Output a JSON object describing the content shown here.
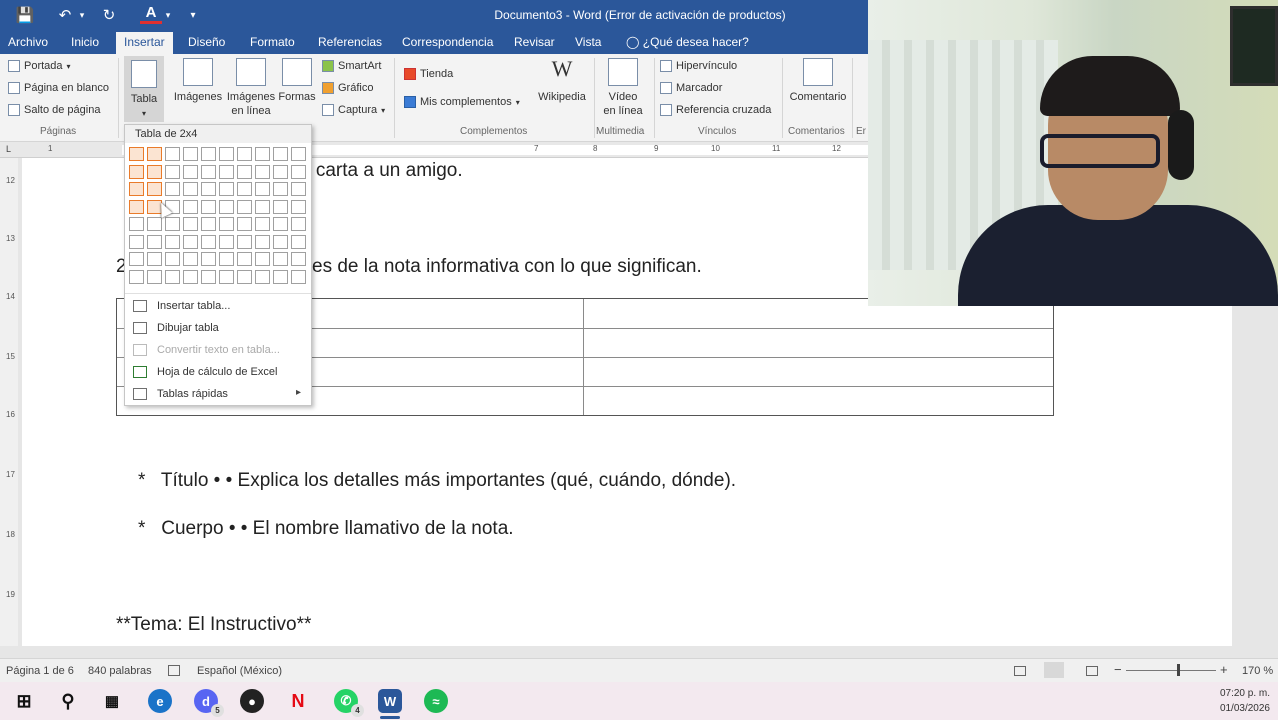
{
  "titlebar": {
    "doc_title": "Documento3 - Word (Error de activación de productos)"
  },
  "tabs": [
    {
      "label": "Archivo"
    },
    {
      "label": "Inicio"
    },
    {
      "label": "Insertar"
    },
    {
      "label": "Diseño"
    },
    {
      "label": "Formato"
    },
    {
      "label": "Referencias"
    },
    {
      "label": "Correspondencia"
    },
    {
      "label": "Revisar"
    },
    {
      "label": "Vista"
    }
  ],
  "tell_me": "¿Qué desea hacer?",
  "ribbon": {
    "paginas": {
      "portada": "Portada",
      "pagina_blanco": "Página en blanco",
      "salto": "Salto de página",
      "group": "Páginas"
    },
    "tabla": "Tabla",
    "imagenes": "Imágenes",
    "imagenes_linea": "Imágenes en línea",
    "formas": "Formas",
    "smartart": "SmartArt",
    "grafico": "Gráfico",
    "captura": "Captura",
    "tienda": "Tienda",
    "mis_complementos": "Mis complementos",
    "wikipedia": "Wikipedia",
    "complementos_group": "Complementos",
    "video": "Vídeo en línea",
    "multimedia_group": "Multimedia",
    "hipervinculo": "Hipervínculo",
    "marcador": "Marcador",
    "referencia_cruzada": "Referencia cruzada",
    "vinculos_group": "Vínculos",
    "comentario": "Comentario",
    "comentarios_group": "Comentarios",
    "er_group": "Er"
  },
  "table_dropdown": {
    "header": "Tabla de 2x4",
    "selected_cols": 2,
    "selected_rows": 4,
    "items": [
      {
        "label": "Insertar tabla...",
        "disabled": false,
        "icon": "table-icon"
      },
      {
        "label": "Dibujar tabla",
        "disabled": false,
        "icon": "pencil-icon"
      },
      {
        "label": "Convertir texto en tabla...",
        "disabled": true,
        "icon": "convert-icon"
      },
      {
        "label": "Hoja de cálculo de Excel",
        "disabled": false,
        "icon": "excel-icon"
      },
      {
        "label": "Tablas rápidas",
        "disabled": false,
        "icon": "quick-table-icon",
        "submenu": true
      }
    ]
  },
  "document": {
    "line1": "a carta a un amigo.",
    "line2_prefix": "2",
    "line2": "es de la nota informativa con lo que significan.",
    "bullet1": "*   Título • • Explica los detalles más importantes (qué, cuándo, dónde).",
    "bullet2": "*   Cuerpo • • El nombre llamativo de la nota.",
    "tema": "**Tema: El Instructivo**"
  },
  "statusbar": {
    "page": "Página 1 de 6",
    "words": "840 palabras",
    "language": "Español (México)",
    "zoom": "170 %"
  },
  "taskbar": {
    "clock_time": "07:20 p. m.",
    "clock_date": "01/03/2026",
    "badge_discord": "5",
    "badge_whatsapp": "4"
  },
  "colors": {
    "word_blue": "#2b579a",
    "selection_orange": "#e97b2a"
  }
}
